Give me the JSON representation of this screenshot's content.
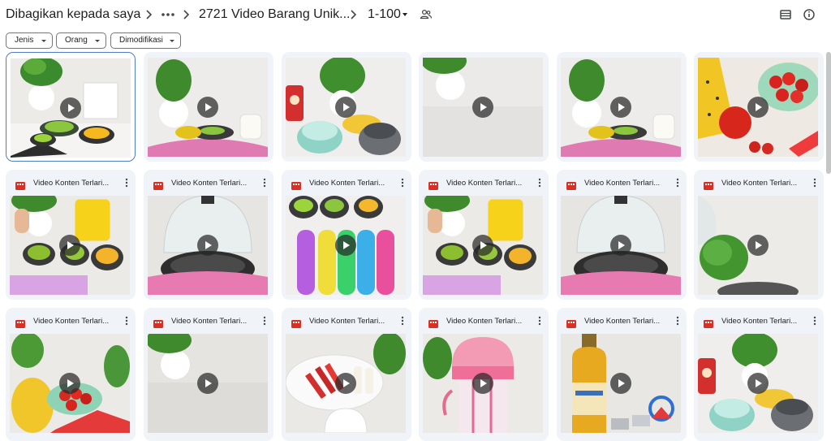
{
  "breadcrumb": {
    "root": "Dibagikan kepada saya",
    "folder": "2721 Video Barang Unik...",
    "current": "1-100"
  },
  "icons": {
    "more": "more-horiz-icon",
    "people": "shared-people-icon",
    "view": "list-view-icon",
    "info": "info-icon",
    "chevron": "chevron-right-icon",
    "file": "video-file-icon",
    "play": "play-icon"
  },
  "filters": {
    "type_label": "Jenis",
    "people_label": "Orang",
    "modified_label": "Dimodifikasi"
  },
  "colors": {
    "file_icon": "#d93025",
    "card_bg": "#f0f4f9",
    "selected_border": "#4f7ec7"
  },
  "files": [
    {
      "name": ""
    },
    {
      "name": ""
    },
    {
      "name": ""
    },
    {
      "name": ""
    },
    {
      "name": ""
    },
    {
      "name": ""
    },
    {
      "name": "Video Konten Terlari..."
    },
    {
      "name": "Video Konten Terlari..."
    },
    {
      "name": "Video Konten Terlari..."
    },
    {
      "name": "Video Konten Terlari..."
    },
    {
      "name": "Video Konten Terlari..."
    },
    {
      "name": "Video Konten Terlari..."
    },
    {
      "name": "Video Konten Terlari..."
    },
    {
      "name": "Video Konten Terlari..."
    },
    {
      "name": "Video Konten Terlari..."
    },
    {
      "name": "Video Konten Terlari..."
    },
    {
      "name": "Video Konten Terlari..."
    },
    {
      "name": "Video Konten Terlari..."
    }
  ]
}
